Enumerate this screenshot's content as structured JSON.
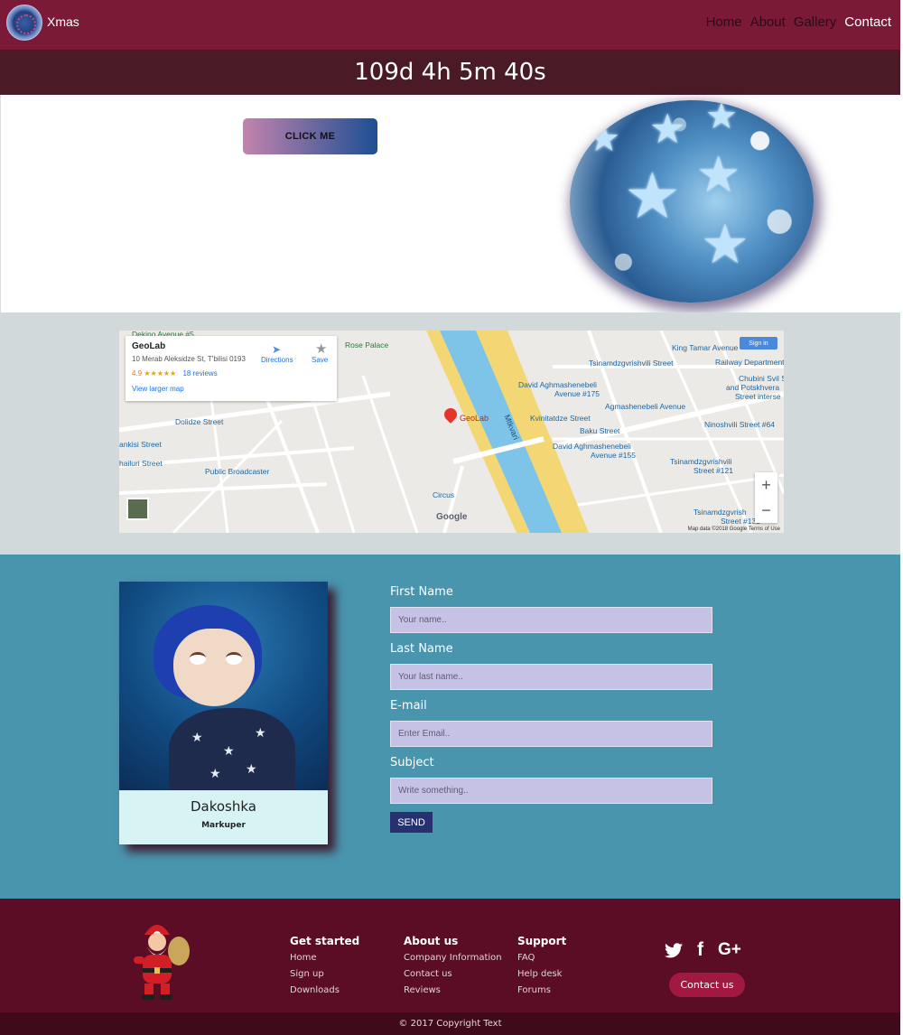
{
  "brand": {
    "name": "Xmas"
  },
  "nav": {
    "items": [
      {
        "label": "Home"
      },
      {
        "label": "About"
      },
      {
        "label": "Gallery"
      },
      {
        "label": "Contact"
      }
    ]
  },
  "countdown": {
    "text": "109d 4h 5m 40s"
  },
  "hero": {
    "button_label": "CLICK ME"
  },
  "map": {
    "card": {
      "title": "GeoLab",
      "address": "10 Merab Aleksidze St, T'bilisi 0193",
      "rating": "4.9",
      "stars": "★★★★★",
      "reviews": "18 reviews",
      "view_larger": "View larger map",
      "directions": "Directions",
      "save": "Save"
    },
    "sign_in": "Sign in",
    "pin_label": "GeoLab",
    "google": "Google",
    "terms": "Map data ©2018 Google    Terms of Use",
    "labels": {
      "l1": "King Tamar Avenue",
      "l2": "Railway Department",
      "l3": "Tsinamdzgvrishvili Street",
      "l4": "Chubini Svil S",
      "l5": "and Potskhvera",
      "l6": "Street interse",
      "l7": "David Aghmashenebeli",
      "l8": "Avenue #175",
      "l9": "Agmashenebeli Avenue",
      "l10": "Kvinitatdze Street",
      "l11": "Baku Street",
      "l12": "Ninoshvili Street #64",
      "l13": "David Aghmashenebeli",
      "l14": "Avenue #155",
      "l15": "Tsinamdzgvrishvili",
      "l16": "Street #121",
      "l17": "Tsinamdzgvrish",
      "l18": "Street #132",
      "l19": "Dolidze Street",
      "l20": "ankisi Street",
      "l21": "hailuri Street",
      "l22": "Public Broadcaster",
      "l23": "Circus",
      "l24": "Mtkvari",
      "l25": "Rose Palace",
      "l26": "Dekino Avenue #5"
    }
  },
  "profile": {
    "name": "Dakoshka",
    "role": "Markuper"
  },
  "form": {
    "first_name_label": "First Name",
    "first_name_placeholder": "Your name..",
    "last_name_label": "Last Name",
    "last_name_placeholder": "Your last name..",
    "email_label": "E-mail",
    "email_placeholder": "Enter Email..",
    "subject_label": "Subject",
    "subject_placeholder": "Write something..",
    "send_label": "SEND"
  },
  "footer": {
    "columns": [
      {
        "title": "Get started",
        "links": [
          "Home",
          "Sign up",
          "Downloads"
        ]
      },
      {
        "title": "About us",
        "links": [
          "Company Information",
          "Contact us",
          "Reviews"
        ]
      },
      {
        "title": "Support",
        "links": [
          "FAQ",
          "Help desk",
          "Forums"
        ]
      }
    ],
    "socials": [
      {
        "icon": "twitter-icon",
        "glyph": "🐦"
      },
      {
        "icon": "facebook-icon",
        "glyph": "f"
      },
      {
        "icon": "google-plus-icon",
        "glyph": "G+"
      }
    ],
    "contact_button": "Contact us",
    "copyright": "© 2017 Copyright Text"
  },
  "colors": {
    "nav_bg": "#7b1a37",
    "countdown_bg": "#4a1a27",
    "map_section_bg": "#d2d9db",
    "contact_section_bg": "#4a95ae",
    "footer_bg": "#5c0d26",
    "copyright_bg": "#3f0a19"
  }
}
